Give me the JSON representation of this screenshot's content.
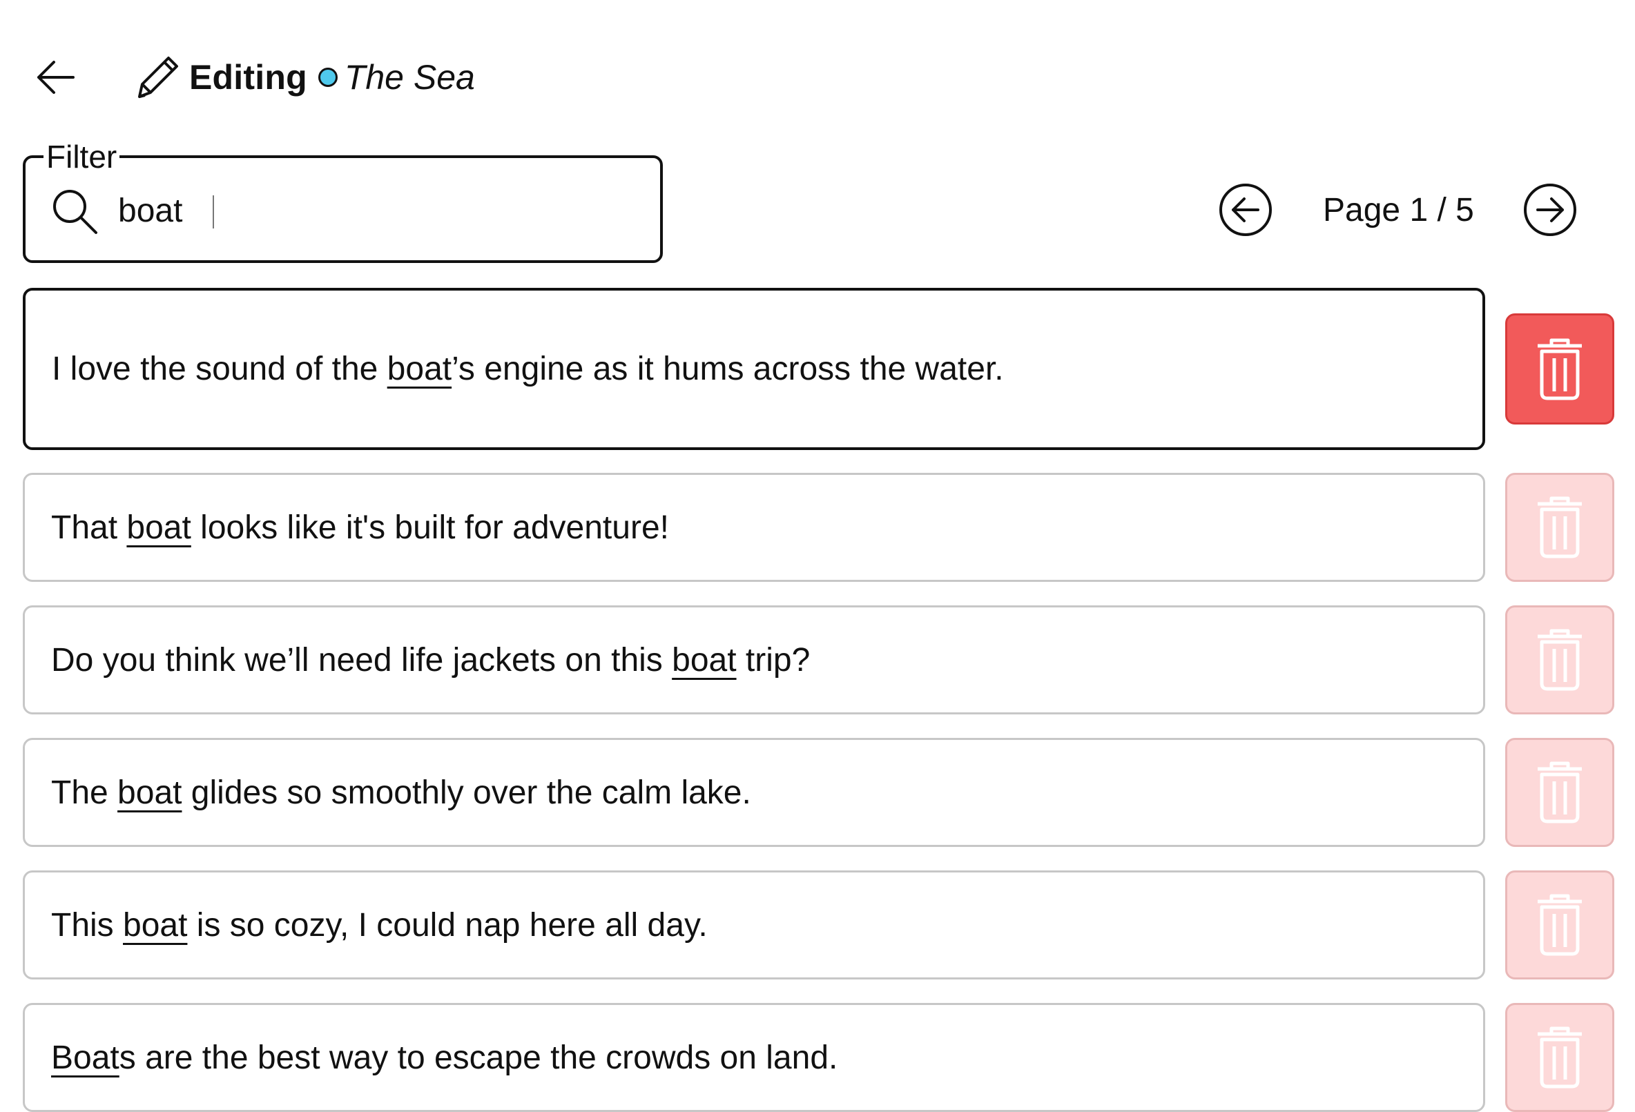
{
  "header": {
    "back_icon": "arrow-left-icon",
    "edit_icon": "pencil-icon",
    "mode_label": "Editing",
    "status_color": "#4fc9ec",
    "document_title": "The Sea"
  },
  "filter": {
    "legend": "Filter",
    "icon": "search-icon",
    "value": "boat"
  },
  "pager": {
    "prev_icon": "arrow-left-circle-icon",
    "next_icon": "arrow-right-circle-icon",
    "label": "Page 1 / 5"
  },
  "sentences": [
    {
      "before": "I love the sound of the ",
      "match": "boat",
      "after": "’s engine as it hums across the water.",
      "selected": true
    },
    {
      "before": "That ",
      "match": "boat",
      "after": " looks like it's built for adventure!",
      "selected": false
    },
    {
      "before": "Do you think we’ll need life jackets on this ",
      "match": "boat",
      "after": " trip?",
      "selected": false
    },
    {
      "before": "The ",
      "match": "boat",
      "after": " glides so smoothly over the calm lake.",
      "selected": false
    },
    {
      "before": "This ",
      "match": "boat",
      "after": " is so cozy, I could nap here all day.",
      "selected": false
    },
    {
      "before": "",
      "match": "Boat",
      "after": "s are the best way to escape the crowds on land.",
      "selected": false
    }
  ],
  "delete_icon": "trash-icon",
  "colors": {
    "delete_active": "#f25a5a",
    "delete_inactive": "#fdd9d9",
    "border_active": "#111111",
    "border_inactive": "#c7c7c7"
  }
}
